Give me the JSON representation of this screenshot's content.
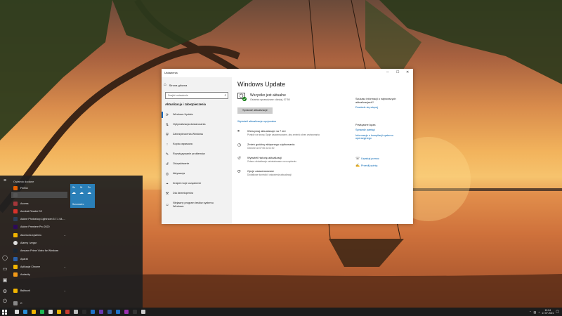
{
  "settings": {
    "title": "Ustawienia",
    "controls": {
      "minimize": "─",
      "maximize": "☐",
      "close": "✕"
    },
    "nav": {
      "home": "Strona główna",
      "search_placeholder": "Znajdź ustawienie",
      "section": "Aktualizacja i zabezpieczenia",
      "items": [
        {
          "label": "Windows Update",
          "icon": "sync-icon"
        },
        {
          "label": "Optymalizacja dostarczania",
          "icon": "delivery-icon"
        },
        {
          "label": "Zabezpieczenia Windows",
          "icon": "shield-icon"
        },
        {
          "label": "Kopia zapasowa",
          "icon": "backup-icon"
        },
        {
          "label": "Rozwiązywanie problemów",
          "icon": "wrench-icon"
        },
        {
          "label": "Odzyskiwanie",
          "icon": "recovery-icon"
        },
        {
          "label": "Aktywacja",
          "icon": "activation-icon"
        },
        {
          "label": "Znajdź moje urządzenie",
          "icon": "find-device-icon"
        },
        {
          "label": "Dla deweloperów",
          "icon": "developer-icon"
        },
        {
          "label": "Niejawny program testów systemu Windows",
          "icon": "insider-icon"
        }
      ]
    },
    "main": {
      "heading": "Windows Update",
      "status_title": "Wszystko jest aktualne",
      "status_sub": "Ostatnio sprawdzane: dzisiaj, 07:50",
      "check_button": "Sprawdź aktualizacje",
      "optional_link": "Wyświetl aktualizacje opcjonalne",
      "options": [
        {
          "title": "Wstrzymaj aktualizacje na 7 dni",
          "desc": "Przejdź na stronę Opcje zaawansowane, aby zmienić okres wstrzymania",
          "icon": "pause-icon"
        },
        {
          "title": "Zmień godziny aktywnego użytkowania",
          "desc": "Obecnie od 07:00 do 01:00",
          "icon": "clock-icon"
        },
        {
          "title": "Wyświetl historię aktualizacji",
          "desc": "Zobacz aktualizacje zainstalowane na urządzeniu",
          "icon": "history-icon"
        },
        {
          "title": "Opcje zaawansowane",
          "desc": "Dodatkowe kontrolki i ustawienia aktualizacji",
          "icon": "advanced-icon"
        }
      ],
      "side": {
        "info_heading": "Szukasz informacji o najnowszych aktualizacjach?",
        "learn_more": "Dowiedz się więcej",
        "related_heading": "Powiązane łącza",
        "storage_link": "Sprawdź pamięć",
        "build_link": "Informacje o kompilacji systemu operacyjnego",
        "help_link": "Uzyskaj pomoc",
        "feedback_link": "Prześlij opinię"
      }
    }
  },
  "start_menu": {
    "header": "Ostatnio dodane",
    "items": [
      {
        "label": "Firefox",
        "color": "#e66000"
      },
      {
        "label": "",
        "color": "#555555"
      },
      {
        "label": "Access",
        "color": "#a4373a"
      },
      {
        "label": "Acrobat Reader DC",
        "color": "#d9322b"
      },
      {
        "label": "Adobe Photoshop Lightroom 5.7.1 64-...",
        "color": "#2b3f59"
      },
      {
        "label": "Adobe Premiere Pro 2020",
        "color": "#2d0a58"
      },
      {
        "label": "Akcesoria systemu",
        "color": "#f0b400"
      },
      {
        "label": "Alarmy i zegar",
        "color": "#e0e0e0"
      },
      {
        "label": "Amazon Prime Video for Windows",
        "color": "#1b2530"
      },
      {
        "label": "Aparat",
        "color": "#2a5fa8"
      },
      {
        "label": "Aplikacje Chrome",
        "color": "#f0b400"
      },
      {
        "label": "Audacity",
        "color": "#f39a18"
      },
      {
        "label": "Baltbunti",
        "color": "#f0b400"
      },
      {
        "label": "C",
        "color": "#888888"
      }
    ],
    "tile": {
      "days": [
        "So",
        "Ni",
        "Pn"
      ],
      "caption": "Sosnowiec"
    }
  },
  "taskbar": {
    "time": "12:04",
    "date": "17.07.2021",
    "apps": [
      {
        "name": "task-view",
        "color": "#dddddd"
      },
      {
        "name": "edge",
        "color": "#2a8fd8"
      },
      {
        "name": "explorer",
        "color": "#f0b400"
      },
      {
        "name": "spotify",
        "color": "#1db954"
      },
      {
        "name": "store",
        "color": "#dddddd"
      },
      {
        "name": "chrome",
        "color": "#e8b400"
      },
      {
        "name": "app-red",
        "color": "#c83a2e"
      },
      {
        "name": "app-settings",
        "color": "#bbbbbb"
      },
      {
        "name": "terminal",
        "color": "#2a2a2a"
      },
      {
        "name": "app-blue",
        "color": "#1e72c8"
      },
      {
        "name": "app-purple",
        "color": "#6a38b0"
      },
      {
        "name": "word",
        "color": "#2b5797"
      },
      {
        "name": "outlook",
        "color": "#1e72c8"
      },
      {
        "name": "app-pink",
        "color": "#9b2fae"
      },
      {
        "name": "app-dark",
        "color": "#333333"
      },
      {
        "name": "settings",
        "color": "#cccccc"
      }
    ]
  }
}
